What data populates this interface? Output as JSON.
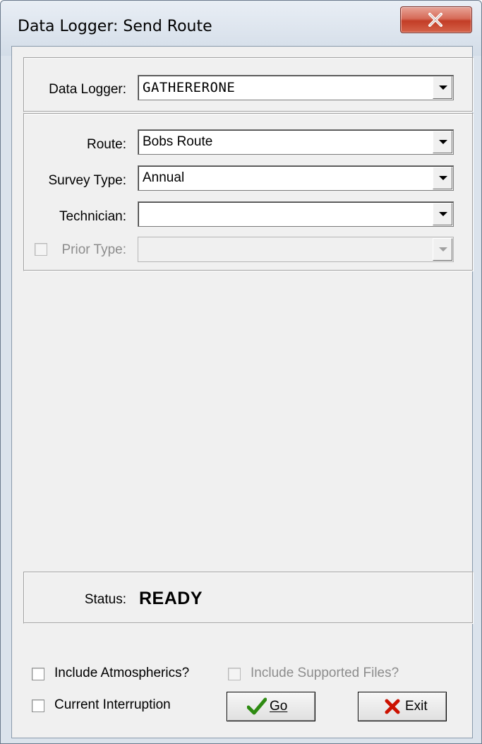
{
  "window": {
    "title": "Data Logger: Send Route",
    "close_glyph": "✕"
  },
  "logger": {
    "label": "Data Logger:",
    "value": "GATHERERONE"
  },
  "route_group": {
    "route": {
      "label": "Route:",
      "value": "Bobs Route"
    },
    "survey_type": {
      "label": "Survey Type:",
      "value": "Annual"
    },
    "technician": {
      "label": "Technician:",
      "value": ""
    },
    "prior_type": {
      "label": "Prior Type:",
      "value": "",
      "enabled": false,
      "checked": false
    }
  },
  "status": {
    "label": "Status:",
    "value": "READY"
  },
  "options": {
    "include_atmospherics": {
      "label": "Include Atmospherics?",
      "checked": false
    },
    "include_supported_files": {
      "label": "Include Supported Files?",
      "checked": false,
      "enabled": false
    },
    "current_interruption": {
      "label": "Current Interruption",
      "checked": false
    }
  },
  "buttons": {
    "go": {
      "label": "Go",
      "accel": "G",
      "icon": "checkmark-icon",
      "color": "#2e8b12"
    },
    "exit": {
      "label": "Exit",
      "accel": "x",
      "icon": "x-icon",
      "color": "#cc1100"
    }
  },
  "colors": {
    "title_bg": "#d3dde8",
    "client_bg": "#f0f0f0",
    "close_red": "#c33d26"
  }
}
